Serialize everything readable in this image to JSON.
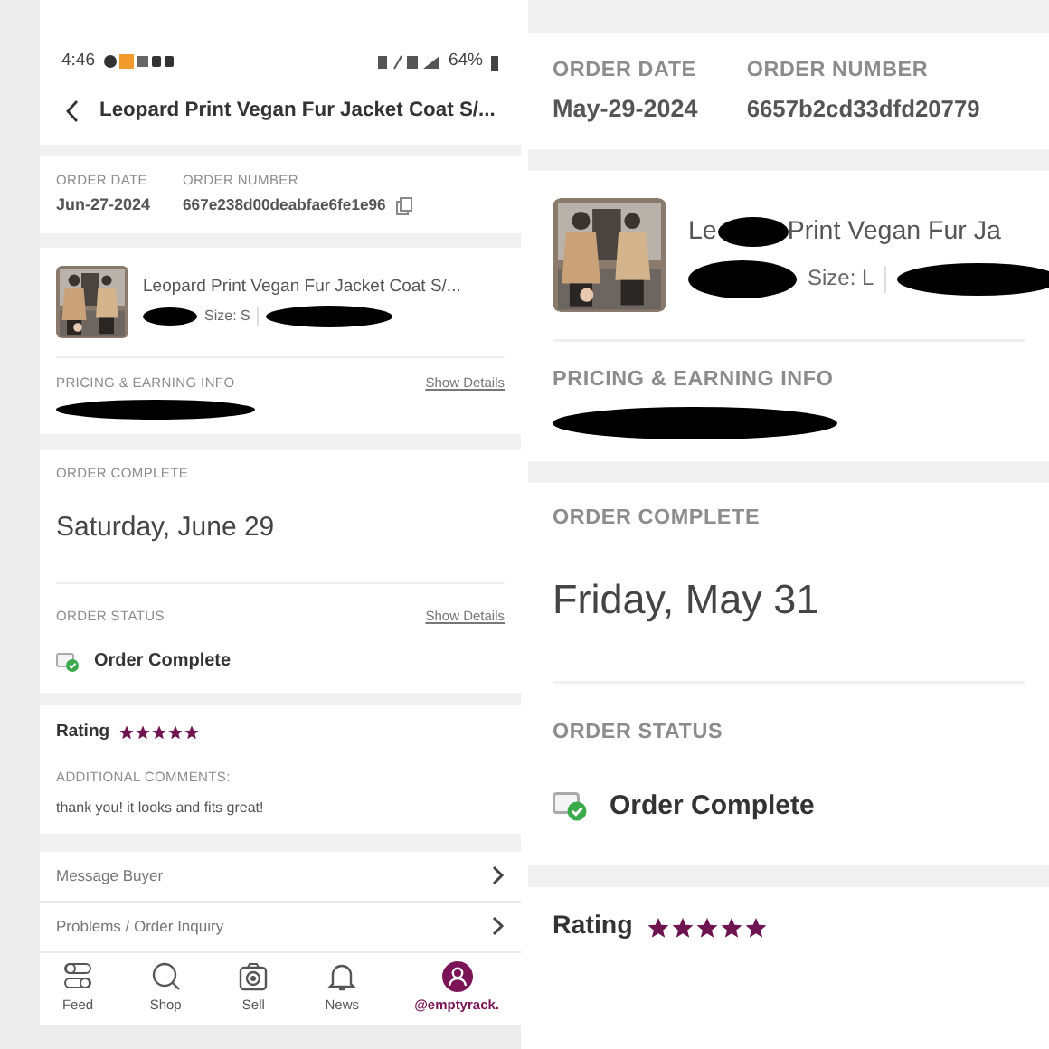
{
  "screens": [
    {
      "status_bar": {
        "time": "4:46",
        "battery": "64%"
      },
      "header": {
        "title": "Leopard Print Vegan Fur Jacket Coat S/..."
      },
      "order_date": {
        "label": "ORDER DATE",
        "value": "Jun-27-2024"
      },
      "order_number": {
        "label": "ORDER NUMBER",
        "value": "667e238d00deabfae6fe1e96"
      },
      "product": {
        "title_parts": [
          "Leopard Print Vegan Fur Jacket Coat S/..."
        ],
        "size": "Size: S"
      },
      "pricing": {
        "label": "PRICING & EARNING INFO",
        "link": "Show Details"
      },
      "order_complete": {
        "label": "ORDER COMPLETE",
        "date": "Saturday, June 29"
      },
      "order_status": {
        "label": "ORDER STATUS",
        "link": "Show Details",
        "status": "Order Complete"
      },
      "rating": {
        "label": "Rating",
        "stars": 5
      },
      "comments": {
        "label": "ADDITIONAL COMMENTS:",
        "text": "thank you! it looks and fits great!"
      },
      "actions": [
        "Message Buyer",
        "Problems / Order Inquiry"
      ],
      "nav": [
        {
          "kind": "feed",
          "label": "Feed",
          "selected": false
        },
        {
          "kind": "shop",
          "label": "Shop",
          "selected": false
        },
        {
          "kind": "sell",
          "label": "Sell",
          "selected": false
        },
        {
          "kind": "news",
          "label": "News",
          "selected": false
        },
        {
          "kind": "profile",
          "label": "@emptyrack.",
          "selected": true
        }
      ]
    },
    {
      "order_date": {
        "label": "ORDER DATE",
        "value": "May-29-2024"
      },
      "order_number": {
        "label": "ORDER NUMBER",
        "value": "6657b2cd33dfd20779"
      },
      "product": {
        "title_parts": [
          "Le",
          "Print Vegan Fur Ja"
        ],
        "size": "Size: L"
      },
      "pricing": {
        "label": "PRICING & EARNING INFO"
      },
      "order_complete": {
        "label": "ORDER COMPLETE",
        "date": "Friday, May 31"
      },
      "order_status": {
        "label": "ORDER STATUS",
        "status": "Order Complete"
      },
      "rating": {
        "label": "Rating",
        "stars": 5
      }
    }
  ]
}
